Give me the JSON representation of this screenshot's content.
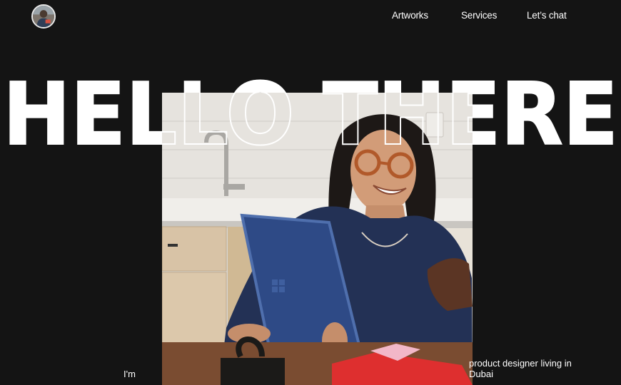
{
  "header": {
    "avatar_icon": "profile-photo",
    "nav": [
      {
        "label": "Artworks"
      },
      {
        "label": "Services"
      },
      {
        "label": "Let’s chat"
      }
    ]
  },
  "hero": {
    "headline": "HELLO THERE",
    "photo_subject": "smiling-woman-holding-tablet"
  },
  "intro": {
    "left_text": "I'm",
    "right_text": "product designer living in Dubai"
  },
  "colors": {
    "background": "#141414",
    "text": "#ffffff"
  }
}
